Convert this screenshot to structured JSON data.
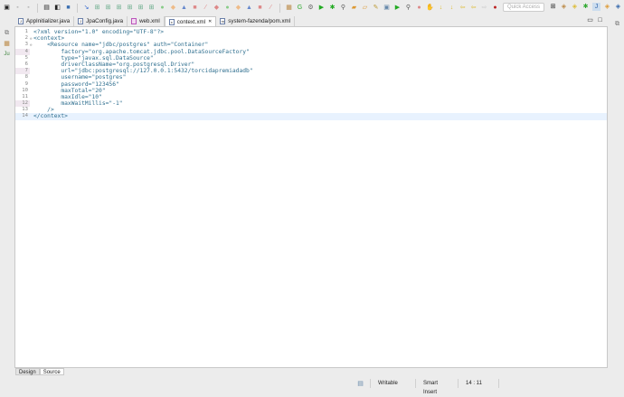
{
  "toolbar": {
    "quick_access_placeholder": "Quick Access"
  },
  "tabs": [
    {
      "label": "AppInitializer.java",
      "icon": "java-file-icon"
    },
    {
      "label": "JpaConfig.java",
      "icon": "java-file-icon"
    },
    {
      "label": "web.xml",
      "icon": "xml-file-icon"
    },
    {
      "label": "context.xml",
      "icon": "xml-file-icon",
      "active": true,
      "close": "✕"
    },
    {
      "label": "system-fazenda/pom.xml",
      "icon": "maven-file-icon"
    }
  ],
  "editor": {
    "lines": [
      {
        "n": "1",
        "text": "<?xml version=\"1.0\" encoding=\"UTF-8\"?>"
      },
      {
        "n": "2",
        "text": "<context>"
      },
      {
        "n": "3",
        "text": "    <Resource name=\"jdbc/postgres\" auth=\"Container\""
      },
      {
        "n": "4",
        "text": "        factory=\"org.apache.tomcat.jdbc.pool.DataSourceFactory\""
      },
      {
        "n": "5",
        "text": "        type=\"javax.sql.DataSource\""
      },
      {
        "n": "6",
        "text": "        driverClassName=\"org.postgresql.Driver\""
      },
      {
        "n": "7",
        "text": "        url=\"jdbc:postgresql://127.0.0.1:5432/torcidapremiadadb\""
      },
      {
        "n": "8",
        "text": "        username=\"postgres\""
      },
      {
        "n": "9",
        "text": "        password=\"123456\""
      },
      {
        "n": "10",
        "text": "        maxTotal=\"20\""
      },
      {
        "n": "11",
        "text": "        maxIdle=\"10\""
      },
      {
        "n": "12",
        "text": "        maxWaitMillis=\"-1\""
      },
      {
        "n": "13",
        "text": "    />"
      },
      {
        "n": "14",
        "text": "</context>"
      }
    ]
  },
  "bottom_tabs": {
    "design": "Design",
    "source": "Source"
  },
  "status": {
    "writable": "Writable",
    "insert_mode": "Smart Insert",
    "position": "14 : 11"
  }
}
